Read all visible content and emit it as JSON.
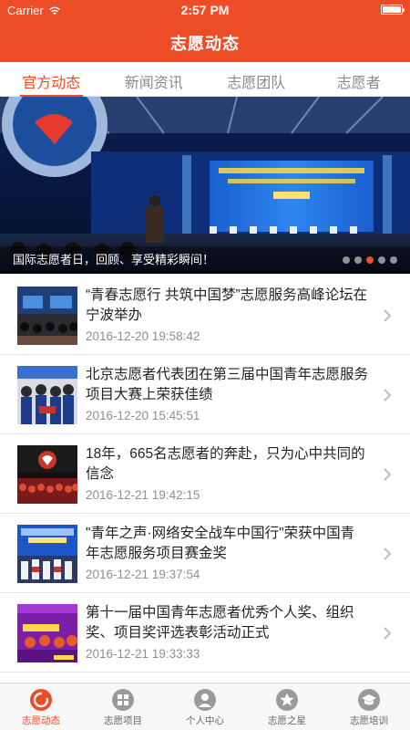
{
  "status_bar": {
    "carrier": "Carrier",
    "time": "2:57 PM"
  },
  "nav": {
    "title": "志愿动态"
  },
  "tabs": [
    {
      "label": "官方动态",
      "active": true
    },
    {
      "label": "新闻资讯",
      "active": false
    },
    {
      "label": "志愿团队",
      "active": false
    },
    {
      "label": "志愿者",
      "active": false
    }
  ],
  "banner": {
    "caption": "国际志愿者日，回顾、享受精彩瞬间！",
    "slide_count": 5,
    "active_slide": 2
  },
  "news": [
    {
      "title": "“青春志愿行 共筑中国梦”志愿服务高峰论坛在宁波举办",
      "date": "2016-12-20 19:58:42"
    },
    {
      "title": "北京志愿者代表团在第三届中国青年志愿服务项目大赛上荣获佳绩",
      "date": "2016-12-20 15:45:51"
    },
    {
      "title": "18年，665名志愿者的奔赴，只为心中共同的信念",
      "date": "2016-12-21 19:42:15"
    },
    {
      "title": "\"青年之声·网络安全战车中国行\"荣获中国青年志愿服务项目赛金奖",
      "date": "2016-12-21 19:37:54"
    },
    {
      "title": "第十一届中国青年志愿者优秀个人奖、组织奖、项目奖评选表彰活动正式",
      "date": "2016-12-21 19:33:33"
    }
  ],
  "tabbar": [
    {
      "label": "志愿动态",
      "icon": "volunteer-news-icon",
      "active": true
    },
    {
      "label": "志愿项目",
      "icon": "projects-grid-icon",
      "active": false
    },
    {
      "label": "个人中心",
      "icon": "person-icon",
      "active": false
    },
    {
      "label": "志愿之星",
      "icon": "star-icon",
      "active": false
    },
    {
      "label": "志愿培训",
      "icon": "training-cap-icon",
      "active": false
    }
  ],
  "colors": {
    "brand": "#ec4d26",
    "inactive_text": "#8a8a8a",
    "date_text": "#8f8f8f"
  }
}
